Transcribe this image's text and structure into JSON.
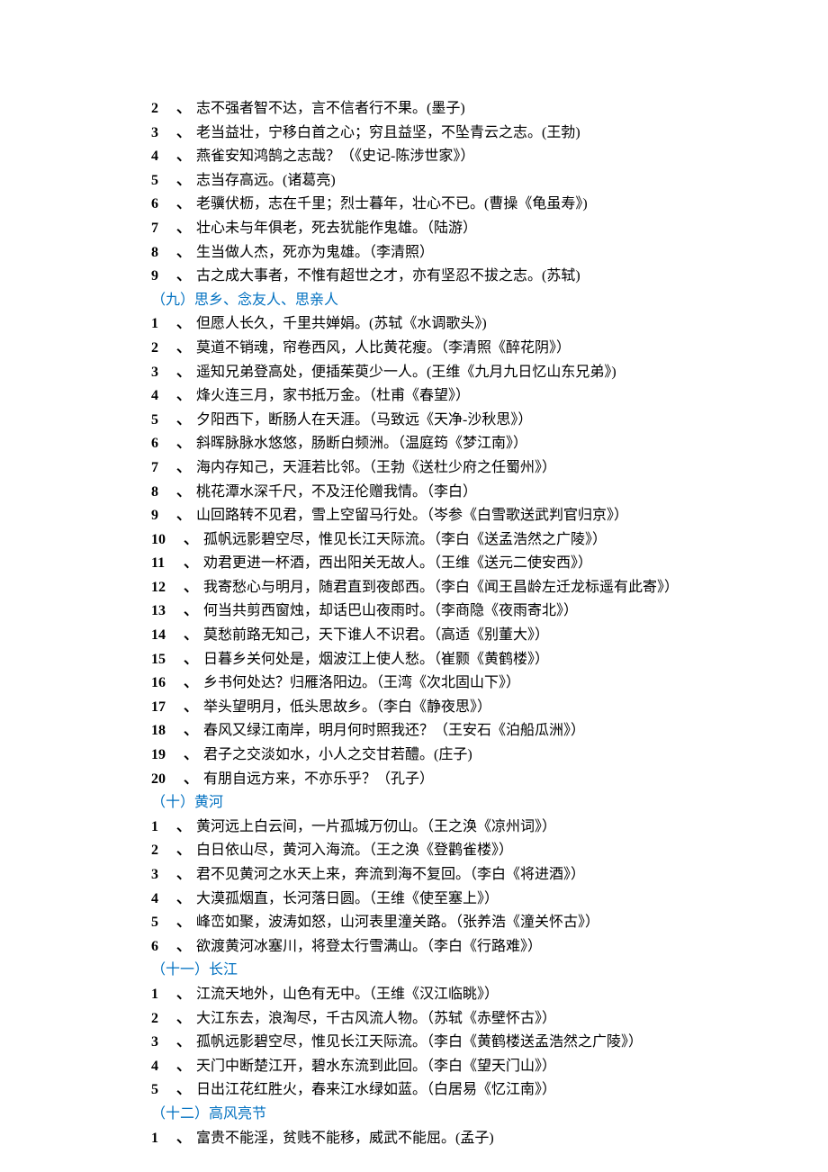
{
  "sections": [
    {
      "heading": null,
      "items": [
        {
          "num": "2",
          "text": "志不强者智不达，言不信者行不果。(墨子)"
        },
        {
          "num": "3",
          "text": "老当益壮，宁移白首之心；穷且益坚，不坠青云之志。(王勃)"
        },
        {
          "num": "4",
          "text": "燕雀安知鸿鹄之志哉？（《史记-陈涉世家》）"
        },
        {
          "num": "5",
          "text": "志当存高远。(诸葛亮)"
        },
        {
          "num": "6",
          "text": "老骥伏枥，志在千里；烈士暮年，壮心不已。(曹操《龟虽寿》)"
        },
        {
          "num": "7",
          "text": "壮心未与年俱老，死去犹能作鬼雄。（陆游）"
        },
        {
          "num": "8",
          "text": "生当做人杰，死亦为鬼雄。（李清照）"
        },
        {
          "num": "9",
          "text": "古之成大事者，不惟有超世之才，亦有坚忍不拔之志。(苏轼)"
        }
      ]
    },
    {
      "heading": "（九）思乡、念友人、思亲人",
      "items": [
        {
          "num": "1",
          "text": "但愿人长久，千里共婵娟。(苏轼《水调歌头》)"
        },
        {
          "num": "2",
          "text": "莫道不销魂，帘卷西风，人比黄花瘦。（李清照《醉花阴》）"
        },
        {
          "num": "3",
          "text": "遥知兄弟登高处，便插茱萸少一人。(王维《九月九日忆山东兄弟》)"
        },
        {
          "num": "4",
          "text": "烽火连三月，家书抵万金。（杜甫《春望》）"
        },
        {
          "num": "5",
          "text": "夕阳西下，断肠人在天涯。（马致远《天净-沙秋思》）"
        },
        {
          "num": "6",
          "text": "斜晖脉脉水悠悠，肠断白频洲。（温庭筠《梦江南》）"
        },
        {
          "num": "7",
          "text": "海内存知己，天涯若比邻。（王勃《送杜少府之任蜀州》）"
        },
        {
          "num": "8",
          "text": "桃花潭水深千尺，不及汪伦赠我情。（李白）"
        },
        {
          "num": "9",
          "text": "山回路转不见君，雪上空留马行处。（岑参《白雪歌送武判官归京》）"
        },
        {
          "num": "10",
          "text": "孤帆远影碧空尽，惟见长江天际流。（李白《送孟浩然之广陵》）"
        },
        {
          "num": "11",
          "text": "劝君更进一杯酒，西出阳关无故人。（王维《送元二使安西》）"
        },
        {
          "num": "12",
          "text": "我寄愁心与明月，随君直到夜郎西。（李白《闻王昌龄左迁龙标遥有此寄》）"
        },
        {
          "num": "13",
          "text": "何当共剪西窗烛，却话巴山夜雨时。（李商隐《夜雨寄北》）"
        },
        {
          "num": "14",
          "text": "莫愁前路无知己，天下谁人不识君。（高适《别董大》）"
        },
        {
          "num": "15",
          "text": "日暮乡关何处是，烟波江上使人愁。（崔颢《黄鹤楼》）"
        },
        {
          "num": "16",
          "text": "乡书何处达？归雁洛阳边。（王湾《次北固山下》）"
        },
        {
          "num": "17",
          "text": "举头望明月，低头思故乡。（李白《静夜思》）"
        },
        {
          "num": "18",
          "text": "春风又绿江南岸，明月何时照我还？（王安石《泊船瓜洲》）"
        },
        {
          "num": "19",
          "text": "君子之交淡如水，小人之交甘若醴。(庄子)"
        },
        {
          "num": "20",
          "text": "有朋自远方来，不亦乐乎？（孔子）"
        }
      ]
    },
    {
      "heading": "（十）黄河",
      "items": [
        {
          "num": "1",
          "text": "黄河远上白云间，一片孤城万仞山。（王之涣《凉州词》）"
        },
        {
          "num": "2",
          "text": "白日依山尽，黄河入海流。（王之涣《登鹳雀楼》）"
        },
        {
          "num": "3",
          "text": "君不见黄河之水天上来，奔流到海不复回。（李白《将进酒》）"
        },
        {
          "num": "4",
          "text": "大漠孤烟直，长河落日圆。（王维《使至塞上》）"
        },
        {
          "num": "5",
          "text": "峰峦如聚，波涛如怒，山河表里潼关路。（张养浩《潼关怀古》）"
        },
        {
          "num": "6",
          "text": "欲渡黄河冰塞川，将登太行雪满山。（李白《行路难》）"
        }
      ]
    },
    {
      "heading": "（十一）长江",
      "items": [
        {
          "num": "1",
          "text": "江流天地外，山色有无中。（王维《汉江临眺》）"
        },
        {
          "num": "2",
          "text": "大江东去，浪淘尽，千古风流人物。（苏轼《赤壁怀古》）"
        },
        {
          "num": "3",
          "text": "孤帆远影碧空尽，惟见长江天际流。（李白《黄鹤楼送孟浩然之广陵》）"
        },
        {
          "num": "4",
          "text": "天门中断楚江开，碧水东流到此回。（李白《望天门山》）"
        },
        {
          "num": "5",
          "text": "日出江花红胜火，春来江水绿如蓝。（白居易《忆江南》）"
        }
      ]
    },
    {
      "heading": "（十二）高风亮节",
      "items": [
        {
          "num": "1",
          "text": "富贵不能淫，贫贱不能移，威武不能屈。(孟子)"
        }
      ]
    }
  ]
}
